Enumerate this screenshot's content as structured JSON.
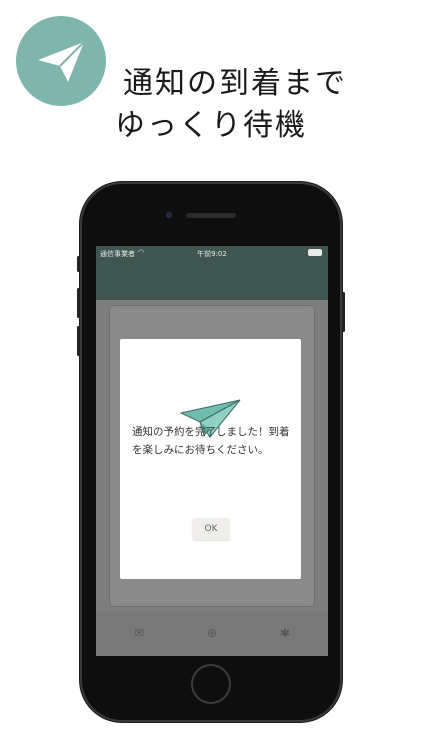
{
  "headline": {
    "line1": "通知の到着まで",
    "line2": "ゆっくり待機"
  },
  "status_bar": {
    "carrier": "通信事業者",
    "time": "午前9:02"
  },
  "dialog": {
    "message": "通知の予約を完了しました！到着を楽しみにお待ちください。",
    "ok_label": "OK"
  },
  "tab_bar": {
    "items": [
      "mail-icon",
      "add-icon",
      "settings-icon"
    ]
  },
  "colors": {
    "accent": "#7fb5ad",
    "nav": "#3f5651",
    "plane": "#6fbcb0"
  }
}
